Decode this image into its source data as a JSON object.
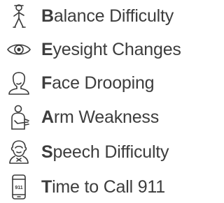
{
  "items": [
    {
      "initial": "B",
      "rest": "alance Difficulty",
      "icon": "walking-person-icon"
    },
    {
      "initial": "E",
      "rest": "yesight Changes",
      "icon": "eye-icon"
    },
    {
      "initial": "F",
      "rest": "ace Drooping",
      "icon": "face-profile-icon"
    },
    {
      "initial": "A",
      "rest": "rm Weakness",
      "icon": "person-arm-icon"
    },
    {
      "initial": "S",
      "rest": "peech Difficulty",
      "icon": "speech-mouth-icon"
    },
    {
      "initial": "T",
      "rest": "ime to Call 911",
      "icon": "phone-911-icon"
    }
  ],
  "phone_screen_text": "911",
  "colors": {
    "text": "#3d3d3d",
    "icon_stroke": "#3a3a3a",
    "background": "#ffffff"
  }
}
